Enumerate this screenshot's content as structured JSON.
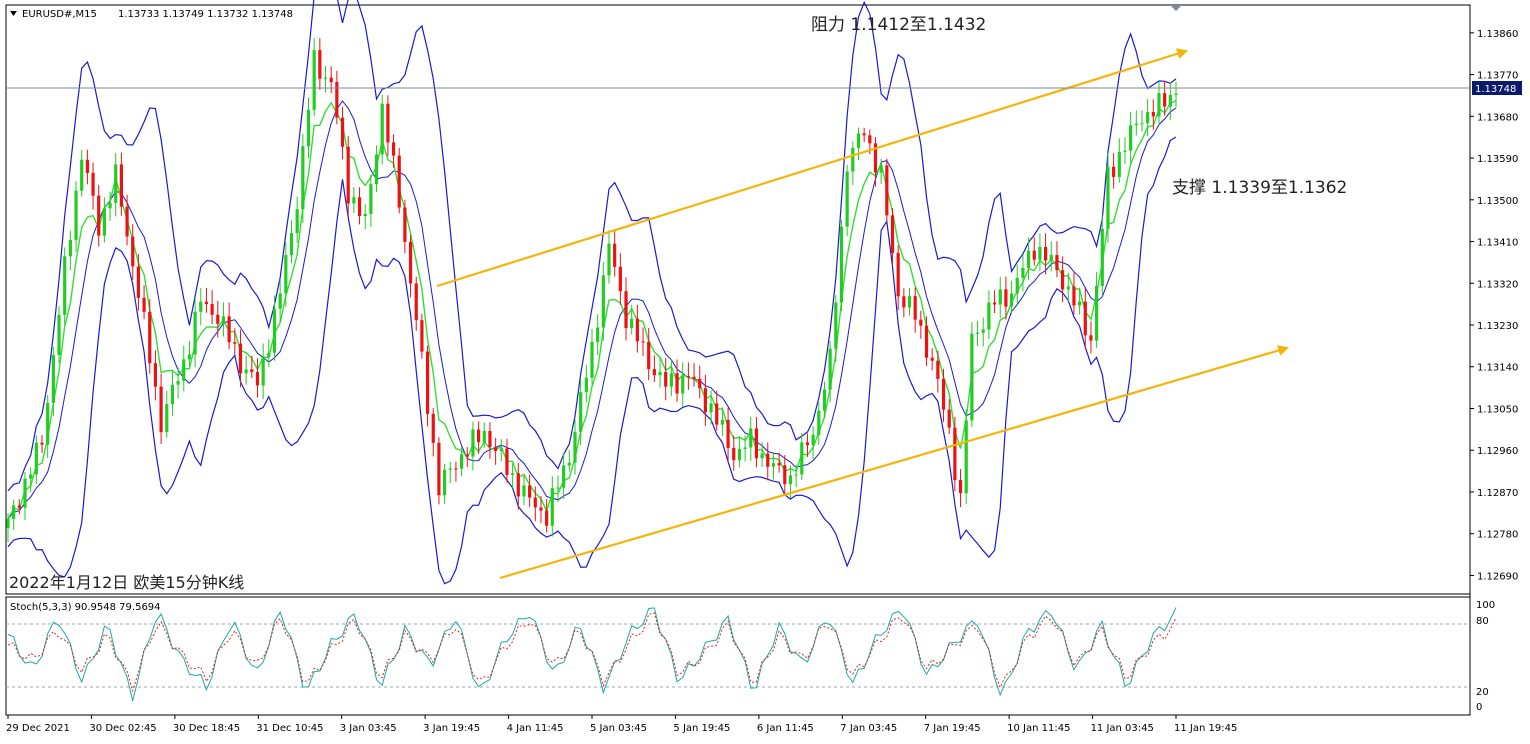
{
  "header": {
    "symbol": "EURUSD#,M15",
    "ohlc": "1.13733 1.13749 1.13732 1.13748"
  },
  "annotations": {
    "resistance": "阻力 1.1412至1.1432",
    "support": "支撑 1.1339至1.1362",
    "footer": "2022年1月12日 欧美15分钟K线"
  },
  "current_price": "1.13748",
  "stoch": {
    "label": "Stoch(5,3,3) 90.9548 79.5694",
    "levels": [
      "100",
      "80",
      "20",
      "0"
    ]
  },
  "colors": {
    "up": "#22cc22",
    "down": "#ee1111",
    "bollinger": "#1a1ad4",
    "ma": "#33dd33",
    "trend": "#f5b40a",
    "stoch_main": "#20a8a0",
    "stoch_signal": "#e02020",
    "price_label_bg": "#0c1a6e"
  },
  "chart_data": {
    "type": "candlestick",
    "y_range": [
      1.1265,
      1.1392
    ],
    "y_ticks": [
      "1.13860",
      "1.13770",
      "1.13680",
      "1.13590",
      "1.13500",
      "1.13410",
      "1.13320",
      "1.13230",
      "1.13140",
      "1.13050",
      "1.12960",
      "1.12870",
      "1.12780",
      "1.12690"
    ],
    "x_ticks": [
      "29 Dec 2021",
      "30 Dec 02:45",
      "30 Dec 18:45",
      "31 Dec 10:45",
      "3 Jan 03:45",
      "3 Jan 19:45",
      "4 Jan 11:45",
      "5 Jan 03:45",
      "5 Jan 19:45",
      "6 Jan 11:45",
      "7 Jan 03:45",
      "7 Jan 19:45",
      "10 Jan 11:45",
      "11 Jan 03:45",
      "11 Jan 19:45"
    ],
    "close_path": [
      [
        0,
        1.128
      ],
      [
        6,
        1.1298
      ],
      [
        10,
        1.1335
      ],
      [
        13,
        1.136
      ],
      [
        16,
        1.1344
      ],
      [
        19,
        1.1355
      ],
      [
        23,
        1.133
      ],
      [
        27,
        1.1302
      ],
      [
        31,
        1.1315
      ],
      [
        34,
        1.1328
      ],
      [
        37,
        1.1325
      ],
      [
        41,
        1.1315
      ],
      [
        44,
        1.131
      ],
      [
        48,
        1.133
      ],
      [
        51,
        1.135
      ],
      [
        54,
        1.138
      ],
      [
        57,
        1.1375
      ],
      [
        60,
        1.1352
      ],
      [
        63,
        1.1345
      ],
      [
        66,
        1.137
      ],
      [
        69,
        1.135
      ],
      [
        73,
        1.1315
      ],
      [
        76,
        1.1288
      ],
      [
        80,
        1.1295
      ],
      [
        84,
        1.13
      ],
      [
        88,
        1.1292
      ],
      [
        92,
        1.1285
      ],
      [
        95,
        1.1282
      ],
      [
        99,
        1.1295
      ],
      [
        103,
        1.1318
      ],
      [
        106,
        1.134
      ],
      [
        109,
        1.1325
      ],
      [
        113,
        1.1315
      ],
      [
        116,
        1.131
      ],
      [
        120,
        1.1312
      ],
      [
        124,
        1.1305
      ],
      [
        128,
        1.1295
      ],
      [
        131,
        1.1298
      ],
      [
        135,
        1.1292
      ],
      [
        138,
        1.129
      ],
      [
        142,
        1.13
      ],
      [
        145,
        1.1315
      ],
      [
        148,
        1.1358
      ],
      [
        151,
        1.1365
      ],
      [
        154,
        1.1355
      ],
      [
        157,
        1.133
      ],
      [
        160,
        1.1325
      ],
      [
        163,
        1.1315
      ],
      [
        166,
        1.13
      ],
      [
        168,
        1.1285
      ],
      [
        170,
        1.132
      ],
      [
        174,
        1.1328
      ],
      [
        177,
        1.133
      ],
      [
        181,
        1.134
      ],
      [
        185,
        1.1335
      ],
      [
        188,
        1.1328
      ],
      [
        191,
        1.132
      ],
      [
        194,
        1.1355
      ],
      [
        197,
        1.1362
      ],
      [
        200,
        1.1368
      ],
      [
        203,
        1.137
      ],
      [
        206,
        1.1374
      ]
    ],
    "stoch_main": [
      70,
      35,
      88,
      25,
      80,
      10,
      92,
      45,
      20,
      85,
      30,
      95,
      15,
      60,
      90,
      20,
      75,
      40,
      88,
      12,
      65,
      92,
      30,
      80,
      18,
      70,
      95,
      25,
      55,
      85,
      15,
      78,
      40,
      90,
      22,
      68,
      96,
      30,
      60,
      85,
      10,
      72,
      93,
      35,
      80,
      20,
      66,
      90
    ],
    "stoch_signal": [
      60,
      45,
      75,
      35,
      70,
      20,
      82,
      50,
      28,
      75,
      38,
      88,
      22,
      55,
      85,
      28,
      70,
      45,
      80,
      20,
      58,
      85,
      38,
      75,
      25,
      62,
      90,
      32,
      50,
      80,
      22,
      70,
      45,
      85,
      30,
      62,
      90,
      36,
      58,
      80,
      18,
      66,
      88,
      40,
      75,
      28,
      60,
      80
    ]
  }
}
